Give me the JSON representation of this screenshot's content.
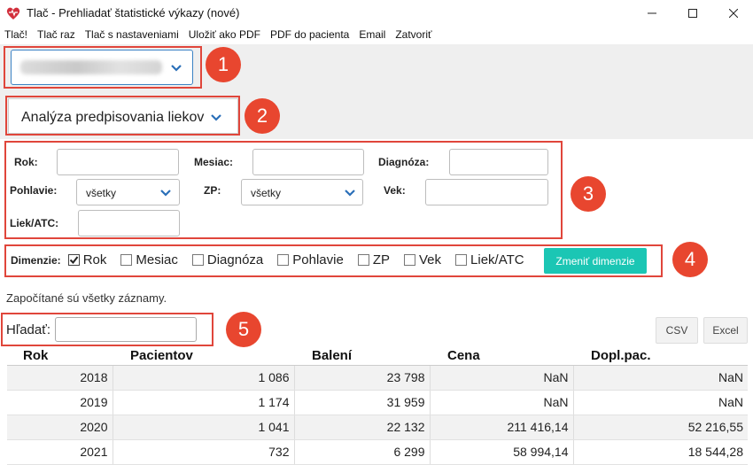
{
  "window": {
    "title": "Tlač - Prehliadať štatistické výkazy (nové)"
  },
  "menu": [
    "Tlač!",
    "Tlač raz",
    "Tlač s nastaveniami",
    "Uložiť ako PDF",
    "PDF do pacienta",
    "Email",
    "Zatvoriť"
  ],
  "badges": [
    "1",
    "2",
    "3",
    "4",
    "5"
  ],
  "report_select": {
    "value": "Analýza predpisovania liekov"
  },
  "filters": {
    "rok_label": "Rok:",
    "mesiac_label": "Mesiac:",
    "diagnoza_label": "Diagnóza:",
    "pohlavie_label": "Pohlavie:",
    "pohlavie_value": "všetky",
    "zp_label": "ZP:",
    "zp_value": "všetky",
    "vek_label": "Vek:",
    "liek_label": "Liek/ATC:"
  },
  "dimensions": {
    "label": "Dimenzie:",
    "items": [
      {
        "label": "Rok",
        "checked": true
      },
      {
        "label": "Mesiac",
        "checked": false
      },
      {
        "label": "Diagnóza",
        "checked": false
      },
      {
        "label": "Pohlavie",
        "checked": false
      },
      {
        "label": "ZP",
        "checked": false
      },
      {
        "label": "Vek",
        "checked": false
      },
      {
        "label": "Liek/ATC",
        "checked": false
      }
    ],
    "change_button": "Zmeniť dimenzie"
  },
  "info_text": "Započítané sú všetky záznamy.",
  "search": {
    "label": "Hľadať:"
  },
  "export": {
    "csv": "CSV",
    "excel": "Excel"
  },
  "table": {
    "headers": [
      "Rok",
      "Pacientov",
      "Balení",
      "Cena",
      "Dopl.pac."
    ],
    "rows": [
      [
        "2018",
        "1 086",
        "23 798",
        "NaN",
        "NaN"
      ],
      [
        "2019",
        "1 174",
        "31 959",
        "NaN",
        "NaN"
      ],
      [
        "2020",
        "1 041",
        "22 132",
        "211 416,14",
        "52 216,55"
      ],
      [
        "2021",
        "732",
        "6 299",
        "58 994,14",
        "18 544,28"
      ]
    ]
  },
  "colors": {
    "accent": "#1bc6b4",
    "annotation": "#e8462f",
    "select_border": "#3b82c4"
  }
}
